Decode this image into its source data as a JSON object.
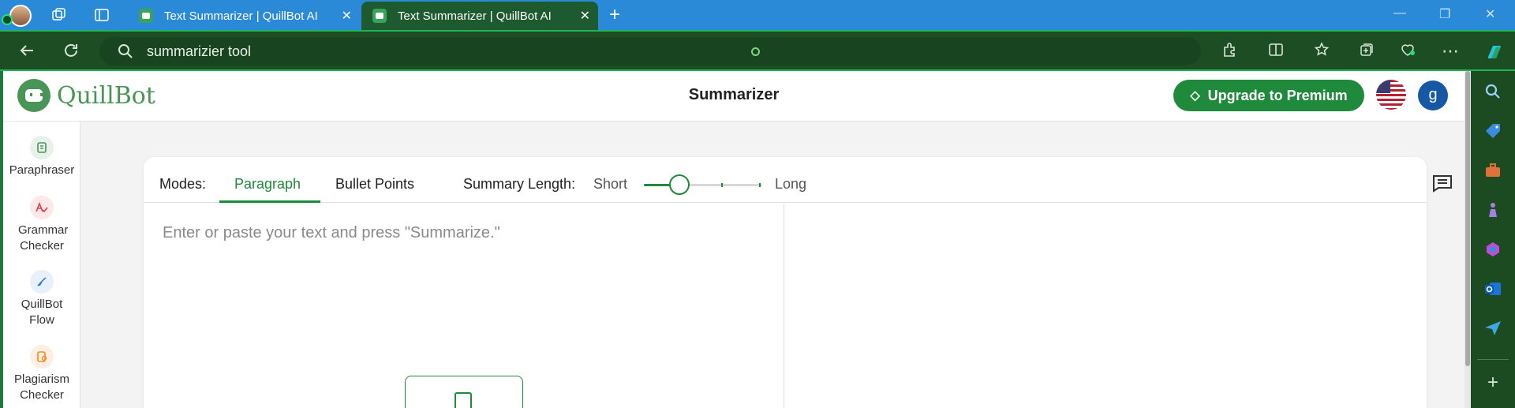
{
  "browser": {
    "tabs": [
      {
        "title": "Text Summarizer | QuillBot AI",
        "active": false
      },
      {
        "title": "Text Summarizer | QuillBot AI",
        "active": true
      }
    ],
    "close_glyph": "✕",
    "new_tab_glyph": "+",
    "address": "summarizier tool"
  },
  "app": {
    "logo_text": "QuillBot",
    "page_title": "Summarizer",
    "upgrade_label": "Upgrade to Premium",
    "user_initial": "g"
  },
  "sidebar": {
    "items": [
      {
        "label": "Paraphraser",
        "icon": "paraphraser-icon",
        "color": "#499557"
      },
      {
        "label": "Grammar Checker",
        "icon": "grammar-checker-icon",
        "color": "#e23d4a"
      },
      {
        "label": "QuillBot Flow",
        "icon": "quillbot-flow-icon",
        "color": "#2f7bd9"
      },
      {
        "label": "Plagiarism Checker",
        "icon": "plagiarism-checker-icon",
        "color": "#f08a24"
      }
    ]
  },
  "summarizer": {
    "modes_label": "Modes:",
    "modes": [
      "Paragraph",
      "Bullet Points"
    ],
    "active_mode": "Paragraph",
    "length_label": "Summary Length:",
    "length_min_label": "Short",
    "length_max_label": "Long",
    "length_value": 0.3,
    "input_placeholder": "Enter or paste your text and press \"Summarize.\""
  },
  "colors": {
    "brand": "#499557",
    "accent": "#1f8a3c",
    "browser_frame": "#1d4d22",
    "tabbar": "#2b8ad8"
  }
}
